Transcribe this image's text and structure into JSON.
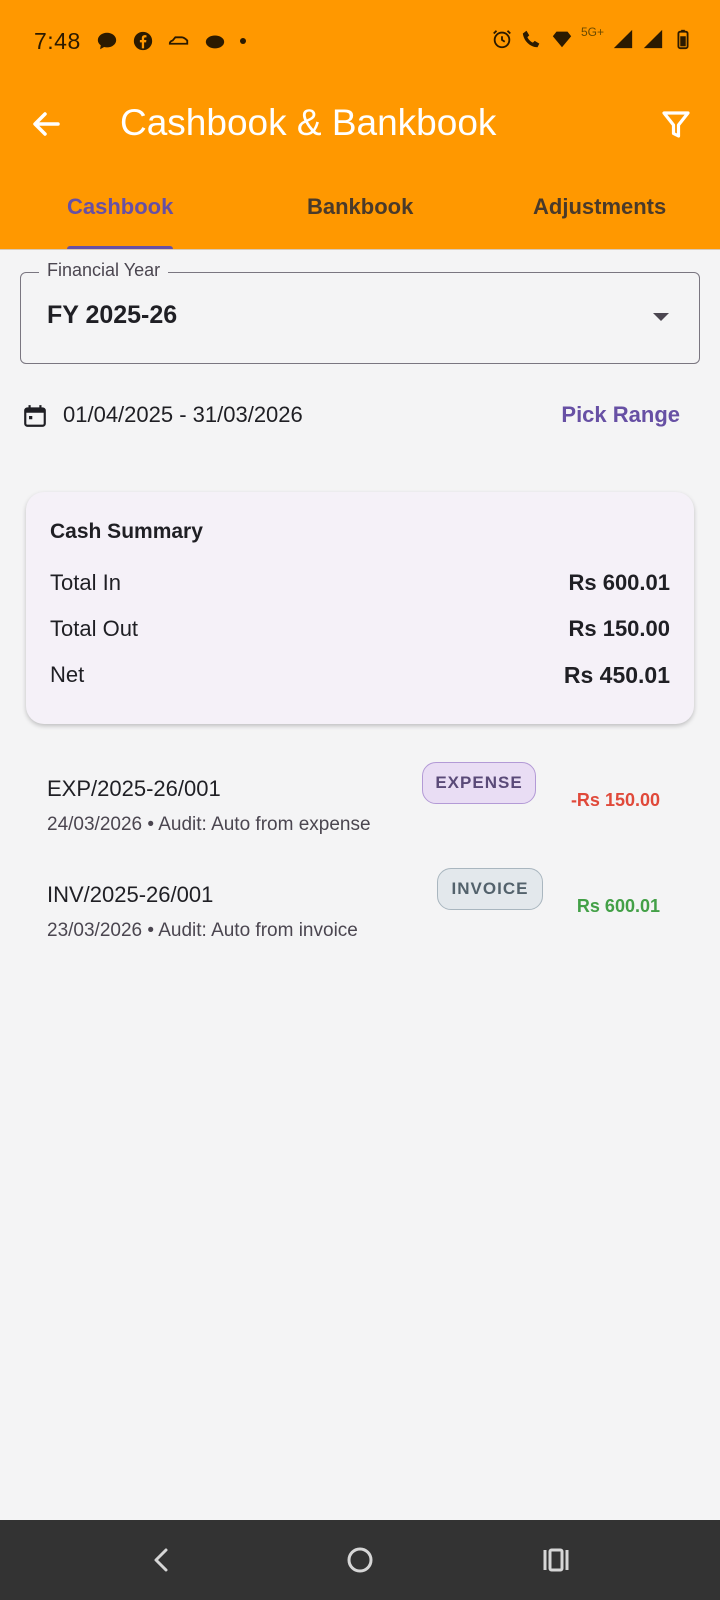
{
  "status_bar": {
    "time": "7:48",
    "left_icons": [
      "chat-bubble-icon",
      "facebook-icon",
      "car-icon",
      "cloud-icon",
      "dot-icon"
    ],
    "right_icons": [
      "alarm-icon",
      "wifi-calling-icon",
      "signal-diamond-icon",
      "cell-signal-icon",
      "cell-signal-icon",
      "battery-icon"
    ],
    "network_label": "5G+"
  },
  "toolbar": {
    "title": "Cashbook & Bankbook",
    "back_icon": "arrow-left-icon",
    "filter_icon": "filter-icon"
  },
  "tabs": [
    {
      "label": "Cashbook",
      "active": true
    },
    {
      "label": "Bankbook",
      "active": false
    },
    {
      "label": "Adjustments",
      "active": false
    }
  ],
  "financial_year": {
    "label": "Financial Year",
    "value": "FY 2025-26"
  },
  "date_range": {
    "text": "01/04/2025 - 31/03/2026",
    "pick_label": "Pick Range"
  },
  "summary": {
    "title": "Cash Summary",
    "rows": [
      {
        "label": "Total In",
        "value": "Rs 600.01"
      },
      {
        "label": "Total Out",
        "value": "Rs 150.00"
      },
      {
        "label": "Net",
        "value": "Rs 450.01"
      }
    ]
  },
  "transactions": [
    {
      "ref": "EXP/2025-26/001",
      "meta": "24/03/2026 • Audit: Auto from expense",
      "tag": "EXPENSE",
      "amount": "-Rs 150.00"
    },
    {
      "ref": "INV/2025-26/001",
      "meta": "23/03/2026 • Audit: Auto from invoice",
      "tag": "INVOICE",
      "amount": "Rs 600.01"
    }
  ],
  "colors": {
    "appbar": "#ff9800",
    "accent": "#6750a4",
    "negative": "#e0493a",
    "positive": "#43a047"
  },
  "nav_bar": {
    "icons": [
      "nav-back-icon",
      "nav-home-icon",
      "nav-recents-icon"
    ]
  }
}
